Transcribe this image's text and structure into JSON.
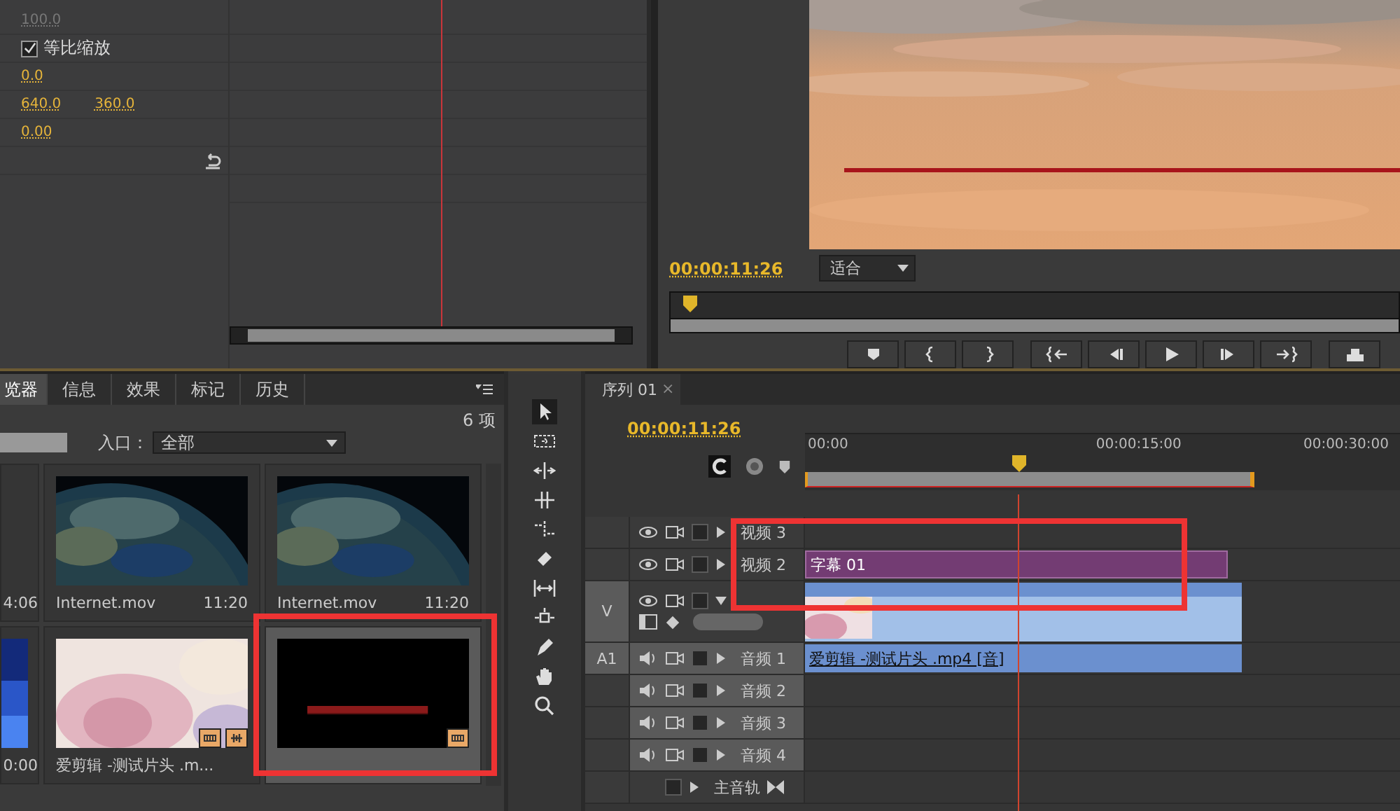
{
  "effect_controls": {
    "rows": [
      {
        "kind": "value",
        "values": [
          "100.0"
        ],
        "disabled": true
      },
      {
        "kind": "checkbox",
        "label": "等比缩放",
        "checked": true
      },
      {
        "kind": "value",
        "values": [
          "0.0"
        ],
        "disabled": false
      },
      {
        "kind": "value",
        "values": [
          "640.0",
          "360.0"
        ],
        "disabled": false
      },
      {
        "kind": "value",
        "values": [
          "0.00"
        ],
        "disabled": false
      },
      {
        "kind": "reset"
      }
    ]
  },
  "program_monitor": {
    "timecode": "00:00:11:26",
    "fit": "适合"
  },
  "project": {
    "tabs": [
      {
        "label": "览器",
        "selected": true
      },
      {
        "label": "信息",
        "selected": false
      },
      {
        "label": "效果",
        "selected": false
      },
      {
        "label": "标记",
        "selected": false
      },
      {
        "label": "历史",
        "selected": false
      }
    ],
    "count": "6 项",
    "entry_label": "入口：",
    "entry_value": "全部",
    "items": [
      {
        "kind": "none",
        "duration": "4:06",
        "selected": false
      },
      {
        "kind": "earth",
        "name": "Internet.mov",
        "duration": "11:20",
        "selected": false
      },
      {
        "kind": "earth",
        "name": "Internet.mov",
        "duration": "11:20",
        "selected": false
      },
      {
        "kind": "blue",
        "duration": "0:00",
        "selected": false
      },
      {
        "kind": "gradient",
        "name": "爱剪辑 -测试片头 .m...",
        "selected": false
      },
      {
        "kind": "title",
        "selected": true
      }
    ]
  },
  "timeline": {
    "tab": "序列 01",
    "close": "×",
    "timecode": "00:00:11:26",
    "ruler": [
      "00:00",
      "00:00:15:00",
      "00:00:30:00"
    ],
    "tracks": [
      {
        "kind": "video",
        "name": "视频 3",
        "expanded": false
      },
      {
        "kind": "video",
        "name": "视频 2",
        "expanded": false,
        "clip": {
          "kind": "title",
          "label": "字幕 01"
        }
      },
      {
        "kind": "video",
        "target": "V",
        "expanded": true,
        "clip": {
          "kind": "video"
        }
      },
      {
        "kind": "audio",
        "target": "A1",
        "name": "音频 1",
        "expanded": false,
        "clip": {
          "kind": "audio",
          "label": "爱剪辑 -测试片头 .mp4 [音]"
        }
      },
      {
        "kind": "audio",
        "name": "音频 2",
        "expanded": false
      },
      {
        "kind": "audio",
        "name": "音频 3",
        "expanded": false
      },
      {
        "kind": "audio",
        "name": "音频 4",
        "expanded": false
      },
      {
        "kind": "master",
        "name": "主音轨"
      }
    ]
  }
}
